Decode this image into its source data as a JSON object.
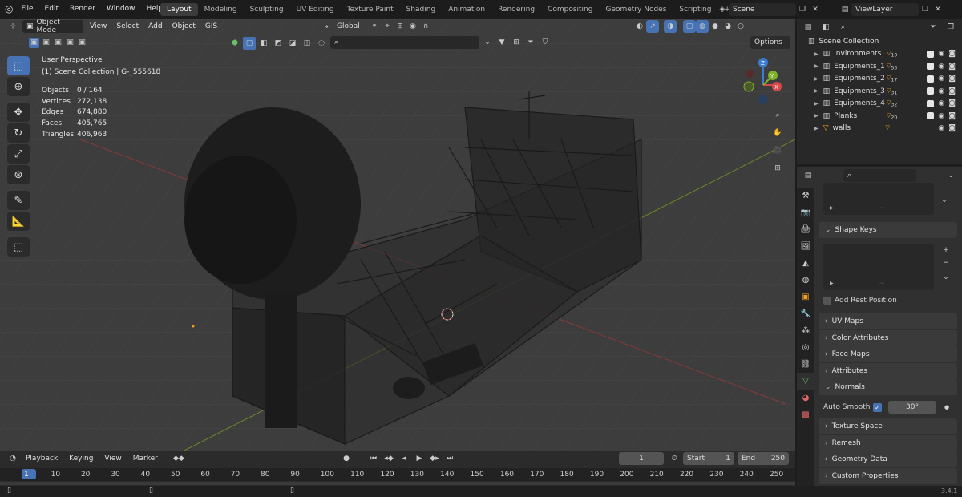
{
  "menus": [
    "File",
    "Edit",
    "Render",
    "Window",
    "Help"
  ],
  "workspaces": [
    "Layout",
    "Modeling",
    "Sculpting",
    "UV Editing",
    "Texture Paint",
    "Shading",
    "Animation",
    "Rendering",
    "Compositing",
    "Geometry Nodes",
    "Scripting"
  ],
  "active_workspace": "Layout",
  "add_workspace": "+",
  "scene": "Scene",
  "view_layer": "ViewLayer",
  "viewport": {
    "mode": "Object Mode",
    "menu": [
      "View",
      "Select",
      "Add",
      "Object",
      "GIS"
    ],
    "orientation": "Global",
    "options_label": "Options",
    "overlay_title": "User Perspective",
    "overlay_subtitle": "(1) Scene Collection | G-_555618",
    "stats": [
      {
        "label": "Objects",
        "value": "0 / 164"
      },
      {
        "label": "Vertices",
        "value": "272,138"
      },
      {
        "label": "Edges",
        "value": "674,880"
      },
      {
        "label": "Faces",
        "value": "405,765"
      },
      {
        "label": "Triangles",
        "value": "406,963"
      }
    ],
    "gizmo": {
      "x": "X",
      "y": "Y",
      "z": "Z"
    }
  },
  "outliner": {
    "root": "Scene Collection",
    "items": [
      {
        "name": "Invironments",
        "badge": "10"
      },
      {
        "name": "Equipments_1",
        "badge": "53"
      },
      {
        "name": "Equipments_2",
        "badge": "17"
      },
      {
        "name": "Equipments_3",
        "badge": "31"
      },
      {
        "name": "Equipments_4",
        "badge": "32"
      },
      {
        "name": "Planks",
        "badge": "20"
      },
      {
        "name": "walls",
        "badge": ""
      }
    ]
  },
  "properties": {
    "shape_keys": "Shape Keys",
    "add_rest_position": "Add Rest Position",
    "panels": [
      "UV Maps",
      "Color Attributes",
      "Face Maps",
      "Attributes",
      "Normals"
    ],
    "auto_smooth_label": "Auto Smooth",
    "auto_smooth_angle": "30°",
    "panels_after": [
      "Texture Space",
      "Remesh",
      "Geometry Data",
      "Custom Properties"
    ]
  },
  "timeline": {
    "menu": [
      "Playback",
      "Keying",
      "View",
      "Marker"
    ],
    "current_frame": "1",
    "start_label": "Start",
    "start": "1",
    "end_label": "End",
    "end": "250",
    "ruler": [
      "1",
      "10",
      "20",
      "30",
      "40",
      "50",
      "60",
      "70",
      "80",
      "90",
      "100",
      "110",
      "120",
      "130",
      "140",
      "150",
      "160",
      "170",
      "180",
      "190",
      "200",
      "210",
      "220",
      "230",
      "240",
      "250"
    ]
  },
  "version": "3.4.1",
  "colors": {
    "accent": "#4772b3",
    "header": "#1c1c1c",
    "viewport": "#3d3d3d",
    "panel": "#303030"
  }
}
